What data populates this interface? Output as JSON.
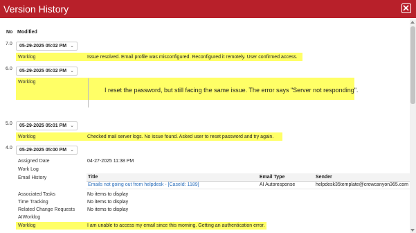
{
  "window": {
    "title": "Version History"
  },
  "columns": {
    "no": "No",
    "modified": "Modified"
  },
  "versions": [
    {
      "no": "7.0",
      "date": "05-29-2025 05:02 PM",
      "field": "Worklog",
      "value": "Issue resolved. Email profile was misconfigured. Reconfigured it remotely. User confirmed access."
    },
    {
      "no": "6.0",
      "date": "05-29-2025 05:02 PM",
      "field": "Worklog",
      "value": "I reset the password, but still facing the same issue. The error says \"Server not responding\"."
    },
    {
      "no": "5.0",
      "date": "05-29-2025 05:01 PM",
      "field": "Worklog",
      "value": "Checked mail server logs. No issue found. Asked user to reset password and try again."
    },
    {
      "no": "4.0",
      "date": "05-29-2025 05:00 PM",
      "fields": {
        "assigned_date": {
          "label": "Assigned Date",
          "value": "04-27-2025 11:38 PM"
        },
        "work_log": {
          "label": "Work Log",
          "value": ""
        },
        "email_history": {
          "label": "Email History"
        },
        "associated_tasks": {
          "label": "Associated Tasks",
          "value": "No items to display"
        },
        "time_tracking": {
          "label": "Time Tracking",
          "value": "No items to display"
        },
        "related_change_requests": {
          "label": "Related Change Requests",
          "value": "No items to display"
        },
        "aiworklog": {
          "label": "AIWorklog",
          "value": ""
        },
        "worklog": {
          "label": "Worklog",
          "value": "I am unable to access my email since this morning. Getting an authentication error."
        }
      },
      "email_table": {
        "headers": [
          "Title",
          "Email Type",
          "Sender"
        ],
        "rows": [
          [
            "Emails not going out from helpdesk - [CaseId: 1189]",
            "AI Autoresponse",
            "helpdesk35template@crowcanyon365.com"
          ]
        ]
      }
    }
  ],
  "colors": {
    "titlebar": "#b8202a",
    "highlight": "#ffff66",
    "link": "#2a6ebb"
  },
  "icons": {
    "close": "close-icon",
    "dropdown": "chevron-down-icon"
  }
}
